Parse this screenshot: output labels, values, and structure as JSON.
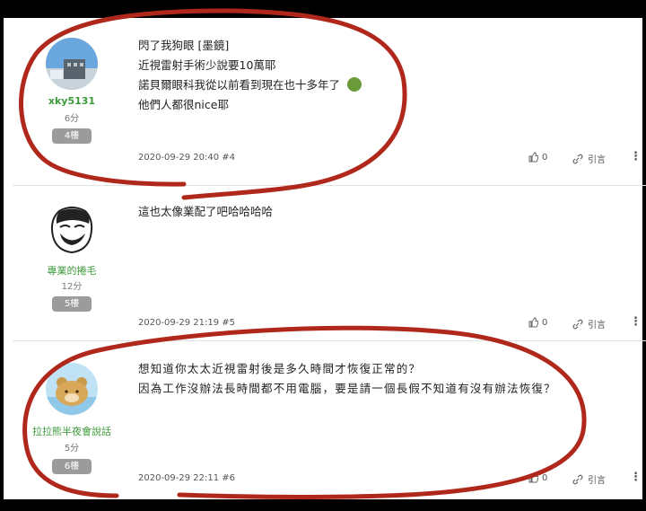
{
  "posts": [
    {
      "author": "xky5131",
      "score": "6分",
      "floor": "4樓",
      "lines": [
        "閃了我狗眼 [墨鏡]",
        "近視雷射手術少說要10萬耶",
        "諾貝爾眼科我從以前看到現在也十多年了",
        "他們人都很nice耶"
      ],
      "emoji": "😠",
      "meta": "2020-09-29 20:40 #4",
      "likes": "0",
      "quote_label": "引言"
    },
    {
      "author": "專業的捲毛",
      "score": "12分",
      "floor": "5樓",
      "lines": [
        "這也太像業配了吧哈哈哈哈"
      ],
      "meta": "2020-09-29 21:19 #5",
      "likes": "0",
      "quote_label": "引言"
    },
    {
      "author": "拉拉熊半夜會說話",
      "score": "5分",
      "floor": "6樓",
      "lines": [
        "想知道你太太近視雷射後是多久時間才恢復正常的？",
        "因為工作沒辦法長時間都不用電腦，要是請一個長假不知道有沒有辦法恢復？"
      ],
      "meta": "2020-09-29 22:11 #6",
      "likes": "0",
      "quote_label": "引言"
    }
  ],
  "icons": {
    "like": "thumbs-up-icon",
    "quote": "quote-link-icon",
    "more": "more-vertical-icon"
  },
  "colors": {
    "author_green": "#3c9a3c",
    "floor_badge": "#9b9b9b",
    "annotation_red": "#b0281c"
  }
}
